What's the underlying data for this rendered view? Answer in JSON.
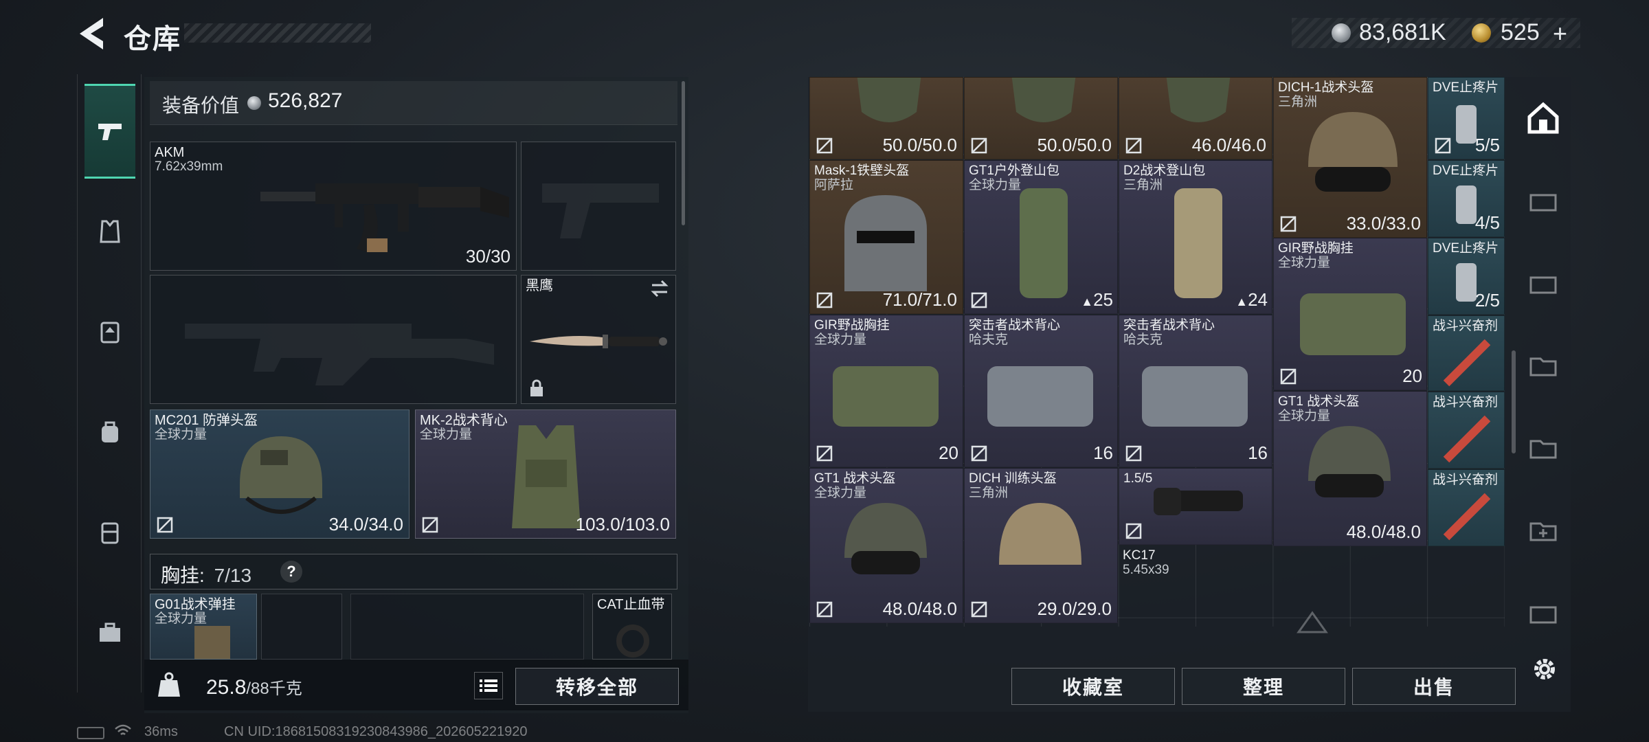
{
  "header": {
    "title": "仓库",
    "silver_balance": "83,681K",
    "gold_balance": "525",
    "plus": "+"
  },
  "left_nav": [
    "weapon-tab",
    "armor-tab",
    "chest-rig-tab",
    "backpack-tab",
    "container-tab",
    "toolbox-tab"
  ],
  "equipment": {
    "value_label": "装备价值",
    "value": "526,827",
    "primary_weapon": {
      "name": "AKM",
      "caliber": "7.62x39mm",
      "ammo": "30/30"
    },
    "melee": {
      "name": "黑鹰"
    },
    "helmet": {
      "name": "MC201 防弹头盔",
      "origin": "全球力量",
      "durability": "34.0/34.0"
    },
    "armor": {
      "name": "MK-2战术背心",
      "origin": "全球力量",
      "durability": "103.0/103.0"
    },
    "chest_rig_label": "胸挂:",
    "chest_rig_count": "7/13",
    "help": "?",
    "rig_item_1": {
      "name": "G01战术弹挂",
      "origin": "全球力量"
    },
    "rig_item_2": {
      "name": "CAT止血带"
    }
  },
  "weight": {
    "value": "25.8",
    "capacity": "/88千克"
  },
  "buttons": {
    "transfer_all": "转移全部",
    "collection": "收藏室",
    "organize": "整理",
    "sell": "出售"
  },
  "status": {
    "ping": "36ms",
    "uid": "CN UID:18681508319230843986_202605221920"
  },
  "stash": {
    "mask_a": "50.0/50.0",
    "mask_b": "50.0/50.0",
    "mask_c": "46.0/46.0",
    "dich1": {
      "name": "DICH-1战术头盔",
      "origin": "三角洲",
      "durability": "33.0/33.0"
    },
    "dve1": {
      "name": "DVE止疼片",
      "uses": "5/5"
    },
    "dve2": {
      "name": "DVE止疼片",
      "uses": "4/5"
    },
    "dve3": {
      "name": "DVE止疼片",
      "uses": "2/5"
    },
    "mask1": {
      "name": "Mask-1铁壁头盔",
      "origin": "阿萨拉",
      "durability": "71.0/71.0"
    },
    "gt1_pack": {
      "name": "GT1户外登山包",
      "origin": "全球力量",
      "capacity": "25"
    },
    "d2_pack": {
      "name": "D2战术登山包",
      "origin": "三角洲",
      "capacity": "24"
    },
    "gir_a": {
      "name": "GIR野战胸挂",
      "origin": "全球力量",
      "capacity": "20"
    },
    "gir_b": {
      "name": "GIR野战胸挂",
      "origin": "全球力量",
      "capacity": "20"
    },
    "assault_a": {
      "name": "突击者战术背心",
      "origin": "哈夫克",
      "capacity": "16"
    },
    "assault_b": {
      "name": "突击者战术背心",
      "origin": "哈夫克",
      "capacity": "16"
    },
    "stim1": {
      "name": "战斗兴奋剂"
    },
    "stim2": {
      "name": "战斗兴奋剂"
    },
    "stim3": {
      "name": "战斗兴奋剂"
    },
    "gt1_helmet_a": {
      "name": "GT1 战术头盔",
      "origin": "全球力量",
      "durability": "48.0/48.0"
    },
    "gt1_helmet_b": {
      "name": "GT1 战术头盔",
      "origin": "全球力量",
      "durability": "48.0/48.0"
    },
    "dich_train": {
      "name": "DICH 训练头盔",
      "origin": "三角洲",
      "durability": "29.0/29.0"
    },
    "scope": {
      "name": "1.5/5"
    },
    "kc17": {
      "name": "KC17",
      "caliber": "5.45x39"
    }
  }
}
